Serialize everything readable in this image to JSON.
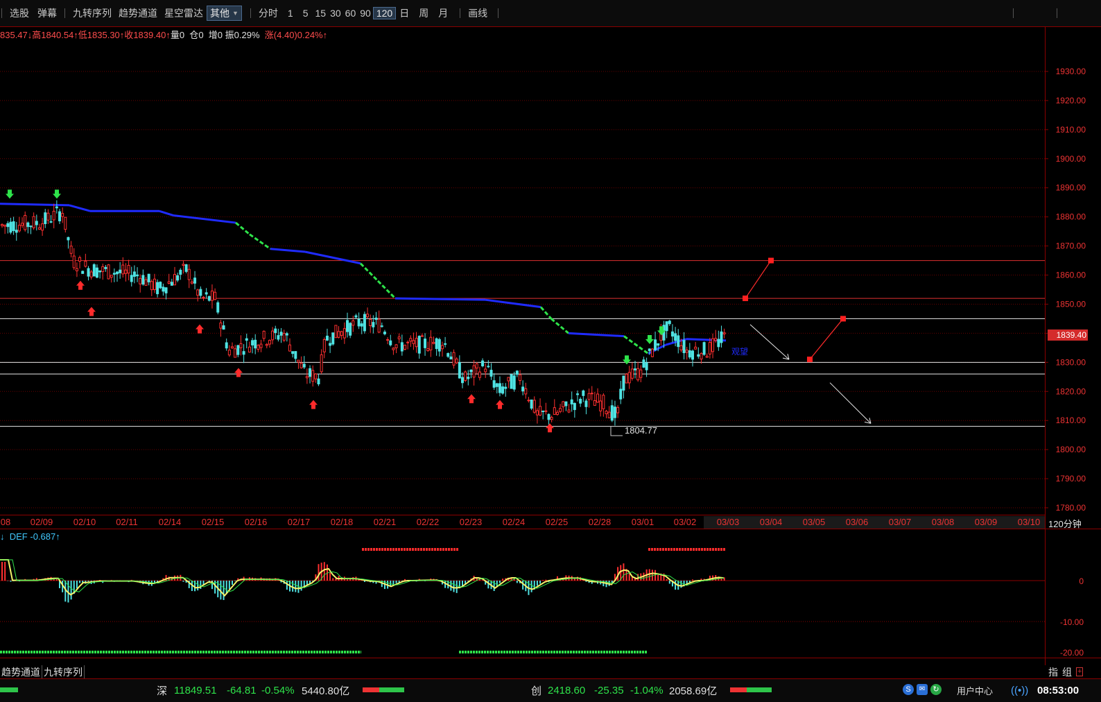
{
  "toolbar": {
    "items": [
      {
        "label": "选股"
      },
      {
        "label": "弹幕"
      },
      {
        "label": "九转序列"
      },
      {
        "label": "趋势通道"
      },
      {
        "label": "星空雷达"
      }
    ],
    "select_value": "其他",
    "periods": [
      "分时",
      "1",
      "5",
      "15",
      "30",
      "60",
      "90",
      "120",
      "日",
      "周",
      "月"
    ],
    "active_period": "120",
    "draw_label": "画线"
  },
  "info": {
    "open": "835.47↓",
    "high_label": "高",
    "high": "1840.54↑",
    "low_label": "低",
    "low": "1835.30↑",
    "close_label": "收",
    "close": "1839.40↑",
    "vol_label": "量",
    "vol": "0",
    "oi_label": "仓",
    "oi": "0",
    "add_label": "增",
    "add": "0",
    "amp_label": "振",
    "amp": "0.29%",
    "chg_label": "涨",
    "chg": "(4.40)0.24%↑"
  },
  "price_axis": [
    "1930.00",
    "1920.00",
    "1910.00",
    "1900.00",
    "1890.00",
    "1880.00",
    "1870.00",
    "1860.00",
    "1850.00",
    "1840.00",
    "1830.00",
    "1820.00",
    "1810.00",
    "1800.00",
    "1790.00",
    "1780.00"
  ],
  "current_price": "1839.40",
  "low_annotation": "1804.77",
  "observe_label": "观望",
  "dates": [
    "08",
    "02/09",
    "02/10",
    "02/11",
    "02/14",
    "02/15",
    "02/16",
    "02/17",
    "02/18",
    "02/21",
    "02/22",
    "02/23",
    "02/24",
    "02/25",
    "02/28",
    "03/01",
    "03/02",
    "03/03",
    "03/04",
    "03/05",
    "03/06",
    "03/07",
    "03/08",
    "03/09",
    "03/10"
  ],
  "period_label": "120分钟",
  "indicator": {
    "label": "DEF",
    "value": "-0.687↑",
    "prefix": "↓",
    "axis": [
      "0",
      "-10.00",
      "-20.00"
    ]
  },
  "bottom_tabs": [
    "趋势通道",
    "九转序列"
  ],
  "ind_tabs": [
    "指",
    "组"
  ],
  "status": {
    "sz_label": "深",
    "sz_value": "11849.51",
    "sz_change": "-64.81",
    "sz_pct": "-0.54%",
    "sz_amount": "5440.80亿",
    "cy_label": "创",
    "cy_value": "2418.60",
    "cy_change": "-25.35",
    "cy_pct": "-1.04%",
    "cy_amount": "2058.69亿",
    "user_center": "用户中心",
    "time": "08:53:00"
  },
  "chart_data": {
    "type": "candlestick",
    "ylim": [
      1776,
      1940
    ],
    "hlines_red": [
      1865,
      1852
    ],
    "hlines_white": [
      1845,
      1830,
      1826,
      1808
    ],
    "channel_points": [
      [
        0,
        1884.5
      ],
      [
        100,
        1884
      ],
      [
        130,
        1882
      ],
      [
        230,
        1882
      ],
      [
        250,
        1880.5
      ],
      [
        340,
        1878
      ],
      [
        360,
        1874
      ],
      [
        390,
        1869
      ],
      [
        440,
        1868
      ],
      [
        520,
        1864
      ],
      [
        545,
        1858
      ],
      [
        570,
        1852
      ],
      [
        700,
        1851.5
      ],
      [
        780,
        1849
      ],
      [
        795,
        1845
      ],
      [
        820,
        1840
      ],
      [
        900,
        1839
      ],
      [
        935,
        1833
      ],
      [
        960,
        1836
      ],
      [
        990,
        1838
      ],
      [
        1047,
        1837.5
      ]
    ],
    "candles": [],
    "signals_sell": [
      [
        14,
        1887
      ],
      [
        82,
        1887
      ],
      [
        904,
        1830
      ],
      [
        937,
        1837
      ],
      [
        954,
        1840
      ]
    ],
    "signals_buy": [
      [
        116,
        1859
      ],
      [
        132,
        1850
      ],
      [
        288,
        1844
      ],
      [
        344,
        1829
      ],
      [
        452,
        1818
      ],
      [
        680,
        1820
      ],
      [
        721,
        1818
      ],
      [
        793,
        1810
      ]
    ],
    "forecast_points": [
      [
        1075,
        1852
      ],
      [
        1112,
        1865
      ],
      [
        1168,
        1831
      ],
      [
        1216,
        1845
      ]
    ],
    "arrows_white": [
      [
        1082,
        1843
      ],
      [
        1138,
        1831
      ],
      [
        1197,
        1823
      ],
      [
        1256,
        1809
      ]
    ]
  }
}
